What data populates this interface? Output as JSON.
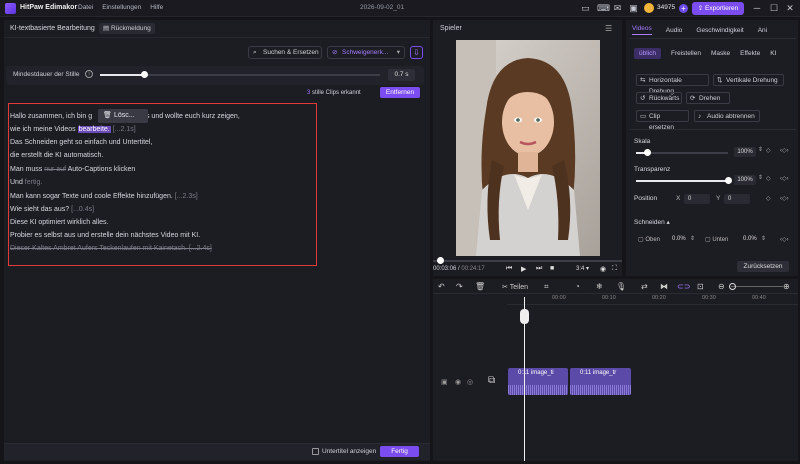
{
  "app": {
    "name": "HitPaw Edimakor",
    "document": "2026-09-02_01"
  },
  "menu": [
    "Datei",
    "Einstellungen",
    "Hilfe"
  ],
  "account": {
    "coins": "34975"
  },
  "header": {
    "export_label": "Exportieren"
  },
  "editor": {
    "title": "KI-textbasierte Bearbeitung",
    "feedback_label": "Rückmeldung",
    "search_replace_label": "Suchen & Ersetzen",
    "silence_dropdown_label": "Schweigenerk...",
    "min_silence_label": "Mindestdauer der Stille",
    "min_silence_value": "0.7 s",
    "min_silence_fraction": 0.16,
    "clips_count": "3",
    "clips_text": "stille Clips erkannt",
    "remove_label": "Entfernen",
    "popup_delete_label": "Lösc...",
    "transcript": {
      "l1a": "Hallo zusammen, ich bin g",
      "l1b": "gs und wollte euch kurz zeigen,",
      "l2a": "wie ich meine Videos",
      "l2b": "bearbeite.",
      "l2c": "[...2.1s]",
      "l3": "Das Schneiden geht so einfach und Untertitel,",
      "l4": "die erstellt die KI automatisch.",
      "l5a": "Man muss",
      "l5b": "nur auf",
      "l5c": "Auto-Captions klicken",
      "l6a": "Und",
      "l6b": "fertig.",
      "l7a": "Man kann sogar Texte und coole Effekte hinzufügen.",
      "l7b": "[...2.3s]",
      "l8a": "Wie sieht das aus?",
      "l8b": "[...0.4s]",
      "l9": "Diese KI optimiert wirklich alles.",
      "l10": "Probier es selbst aus und erstelle dein nächstes Video mit KI.",
      "l11": "Dieser Kaltes Ambret Aufers Teckenlaufen mit Kainetach. [...2.4s]"
    },
    "show_subtitles_label": "Untertitel anzeigen",
    "done_label": "Fertig"
  },
  "player": {
    "title": "Spieler",
    "time_current": "00:03:06",
    "time_total": "00:24:17",
    "ratio": "3:4",
    "progress_fraction": 0.04
  },
  "properties": {
    "tabs": [
      "Videos",
      "Audio",
      "Geschwindigkeit",
      "Ani"
    ],
    "subtabs": [
      "üblich",
      "Freistellen",
      "Maske",
      "Effekte",
      "KI"
    ],
    "flip_h": "Horizontale Drehung",
    "flip_v": "Vertikale Drehung",
    "reverse": "Rückwärts",
    "rotate": "Drehen",
    "replace_clip": "Clip ersetzen",
    "detach_audio": "Audio abtrennen",
    "scale_label": "Skala",
    "scale_value": "100%",
    "scale_fraction": 0.12,
    "opacity_label": "Transparenz",
    "opacity_value": "100%",
    "opacity_fraction": 1.0,
    "position_label": "Position",
    "pos_x_label": "X",
    "pos_x": "0",
    "pos_y_label": "Y",
    "pos_y": "0",
    "crop_label": "Schneiden",
    "crop_top_label": "Oben",
    "crop_top": "0.0%",
    "crop_bottom_label": "Unten",
    "crop_bottom": "0.0%",
    "reset_label": "Zurücksetzen"
  },
  "timeline": {
    "split_label": "Teilen",
    "ruler": [
      "00:00",
      "00:10",
      "00:20",
      "00:30",
      "00:40",
      "00:50"
    ],
    "clip1": "0:11 image_ti",
    "clip2": "0:11 image_tr"
  }
}
